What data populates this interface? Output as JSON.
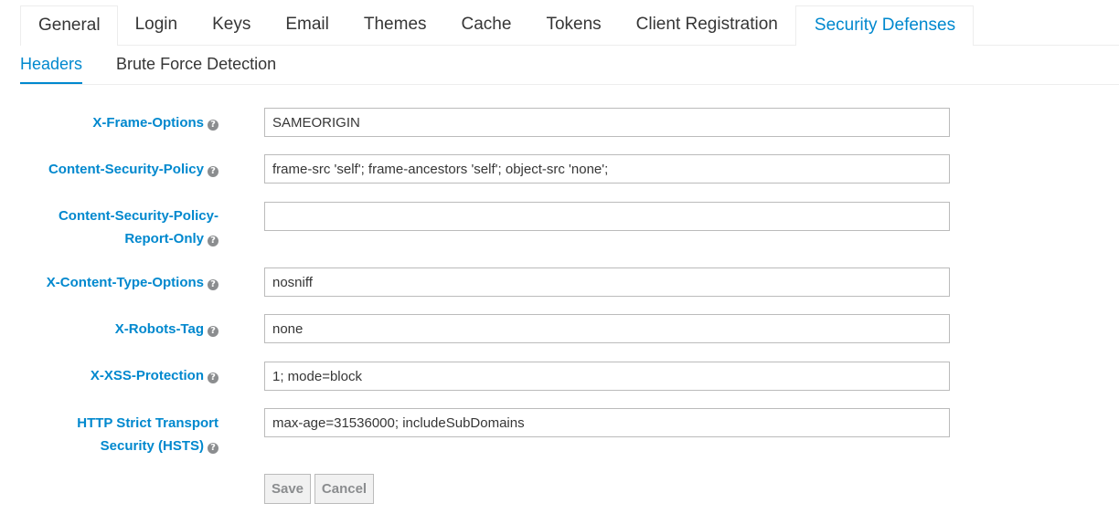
{
  "tabs": [
    {
      "label": "General"
    },
    {
      "label": "Login"
    },
    {
      "label": "Keys"
    },
    {
      "label": "Email"
    },
    {
      "label": "Themes"
    },
    {
      "label": "Cache"
    },
    {
      "label": "Tokens"
    },
    {
      "label": "Client Registration"
    },
    {
      "label": "Security Defenses"
    }
  ],
  "subtabs": [
    {
      "label": "Headers"
    },
    {
      "label": "Brute Force Detection"
    }
  ],
  "form": {
    "x_frame_options": {
      "label": "X-Frame-Options",
      "value": "SAMEORIGIN"
    },
    "csp": {
      "label": "Content-Security-Policy",
      "value": "frame-src 'self'; frame-ancestors 'self'; object-src 'none';"
    },
    "csp_report_only": {
      "label_line1": "Content-Security-Policy-",
      "label_line2": "Report-Only",
      "value": ""
    },
    "x_content_type_options": {
      "label": "X-Content-Type-Options",
      "value": "nosniff"
    },
    "x_robots_tag": {
      "label": "X-Robots-Tag",
      "value": "none"
    },
    "x_xss_protection": {
      "label": "X-XSS-Protection",
      "value": "1; mode=block"
    },
    "hsts": {
      "label_line1": "HTTP Strict Transport",
      "label_line2": "Security (HSTS)",
      "value": "max-age=31536000; includeSubDomains"
    }
  },
  "buttons": {
    "save": "Save",
    "cancel": "Cancel"
  },
  "help_icon_glyph": "?",
  "colors": {
    "accent": "#0088ce",
    "text": "#363636"
  }
}
